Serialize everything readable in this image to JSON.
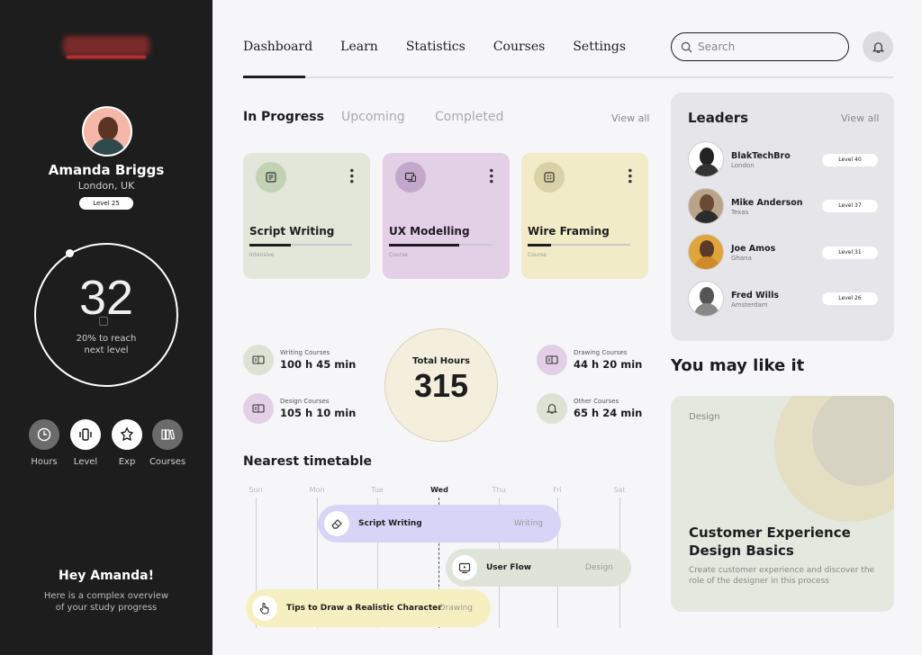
{
  "sidebar": {
    "user": {
      "name": "Amanda Briggs",
      "location": "London, UK",
      "level": "Level 25"
    },
    "progress": {
      "value": "32",
      "caption_line1": "20% to reach",
      "caption_line2": "next level"
    },
    "stats": [
      {
        "label": "Hours",
        "icon": "clock-icon"
      },
      {
        "label": "Level",
        "icon": "level-icon"
      },
      {
        "label": "Exp",
        "icon": "exp-icon"
      },
      {
        "label": "Courses",
        "icon": "books-icon"
      }
    ],
    "greeting": {
      "title": "Hey Amanda!",
      "line1": "Here is a complex overview",
      "line2": "of your study progress"
    }
  },
  "nav": {
    "items": [
      "Dashboard",
      "Learn",
      "Statistics",
      "Courses",
      "Settings"
    ],
    "active": "Dashboard",
    "search_placeholder": "Search"
  },
  "courses": {
    "tabs": [
      "In Progress",
      "Upcoming",
      "Completed"
    ],
    "active_tab": "In Progress",
    "view_all": "View all",
    "cards": [
      {
        "title": "Script Writing",
        "category": "Intensive",
        "progress": 0.4,
        "color": "#e3e7d9",
        "icon_bg": "#c3d1b5",
        "icon": "document-icon"
      },
      {
        "title": "UX Modelling",
        "category": "Course",
        "progress": 0.68,
        "color": "#e3cfe6",
        "icon_bg": "#c4a8cc",
        "icon": "devices-icon"
      },
      {
        "title": "Wire Framing",
        "category": "Course",
        "progress": 0.23,
        "color": "#f1ebc7",
        "icon_bg": "#d9d2a8",
        "icon": "grid-icon"
      }
    ]
  },
  "hours": {
    "total_label": "Total Hours",
    "total_value": "315",
    "items": [
      {
        "label": "Writing Courses",
        "value": "100 h 45 min"
      },
      {
        "label": "Design Courses",
        "value": "105 h 10 min"
      },
      {
        "label": "Drawing Courses",
        "value": "44 h 20 min"
      },
      {
        "label": "Other Courses",
        "value": "65 h 24 min"
      }
    ]
  },
  "timetable": {
    "title": "Nearest timetable",
    "days": [
      "Sun",
      "Mon",
      "Tue",
      "Wed",
      "Thu",
      "Fri",
      "Sat"
    ],
    "active_day": "Wed",
    "events": [
      {
        "title": "Script Writing",
        "category": "Writing"
      },
      {
        "title": "User Flow",
        "category": "Design"
      },
      {
        "title": "Tips to Draw a Realistic Character",
        "category": "Drawing"
      }
    ]
  },
  "leaders": {
    "title": "Leaders",
    "view_all": "View all",
    "list": [
      {
        "name": "BlakTechBro",
        "location": "London",
        "level": "Level 40"
      },
      {
        "name": "Mike Anderson",
        "location": "Texas",
        "level": "Level 37"
      },
      {
        "name": "Joe Amos",
        "location": "Ghana",
        "level": "Level 31"
      },
      {
        "name": "Fred Wills",
        "location": "Amsterdam",
        "level": "Level 26"
      }
    ]
  },
  "recommend": {
    "title": "You may like it",
    "card": {
      "tag": "Design",
      "title": "Customer Experience Design Basics",
      "description": "Create customer experience and discover the role of the designer in this process"
    }
  }
}
